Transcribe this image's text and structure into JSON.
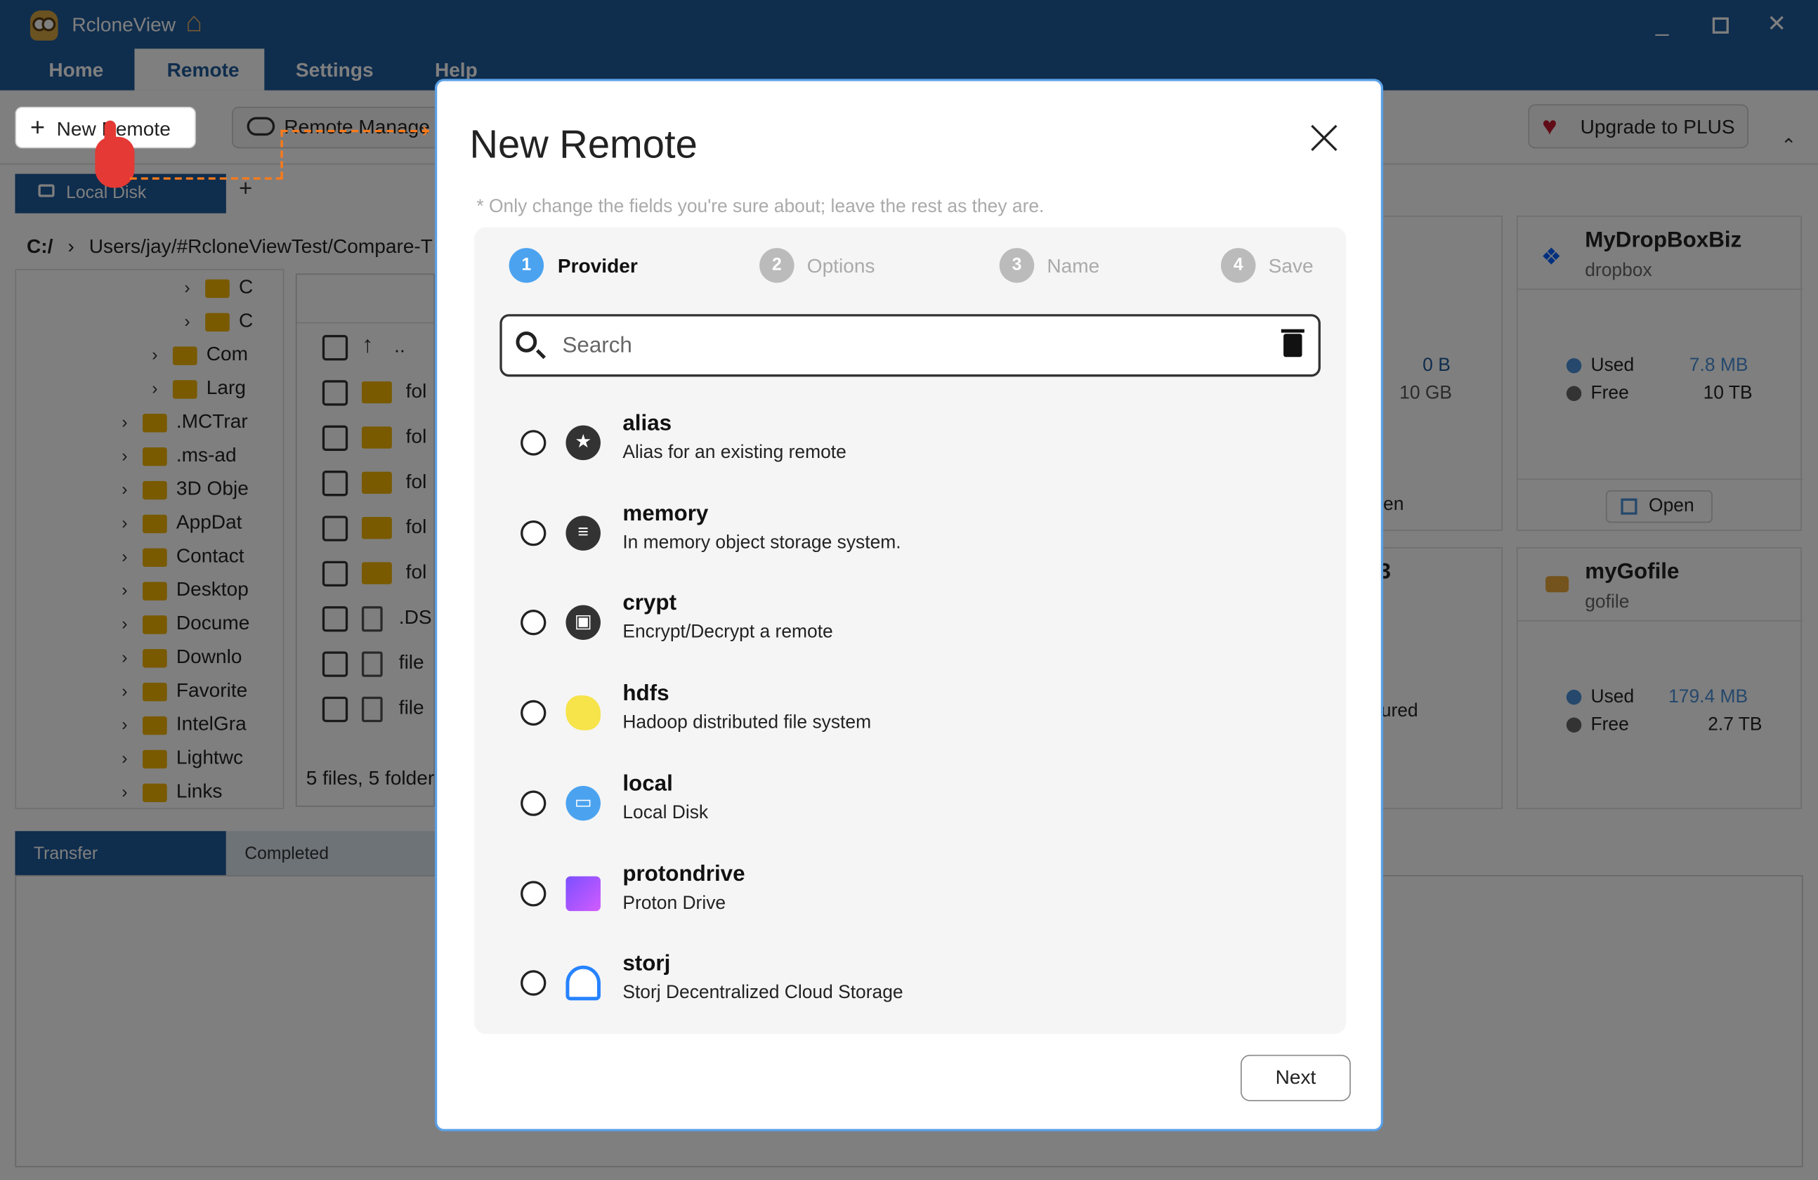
{
  "app": {
    "title": "RcloneView"
  },
  "menu_tabs": [
    "Home",
    "Remote",
    "Settings",
    "Help"
  ],
  "toolbar": {
    "new_remote": "New Remote",
    "remote_manager": "Remote Manage",
    "upgrade": "Upgrade to PLUS"
  },
  "left_panel": {
    "tab": "Local Disk",
    "path_root": "C:/",
    "path": "Users/jay/#RcloneViewTest/Compare-T",
    "tree_items": [
      "C",
      "C",
      "Com",
      "Larg",
      ".MCTrar",
      ".ms-ad",
      "3D Obje",
      "AppDat",
      "Contact",
      "Desktop",
      "Docume",
      "Downlo",
      "Favorite",
      "IntelGra",
      "Lightwc",
      "Links"
    ],
    "files": [
      "..",
      "fol",
      "fol",
      "fol",
      "fol",
      "fol",
      ".DS",
      "file",
      "file"
    ],
    "status": "5 files, 5 folder"
  },
  "bottom_tabs": [
    "Transfer",
    "Completed"
  ],
  "remote_cards": [
    {
      "name": "MyDropBoxBiz",
      "type": "dropbox",
      "used_label": "Used",
      "used": "7.8 MB",
      "free_label": "Free",
      "free": "10 TB",
      "open": "Open"
    },
    {
      "name": "myGofile",
      "type": "gofile",
      "used_label": "Used",
      "used": "179.4 MB",
      "free_label": "Free",
      "free": "2.7 TB"
    }
  ],
  "hidden_card": {
    "used": "0 B",
    "free": "10 GB",
    "open_partial": "en",
    "b_partial": "3",
    "status_partial": "ured"
  },
  "dialog": {
    "title": "New Remote",
    "note": "* Only change the fields you're sure about; leave the rest as they are.",
    "steps": [
      {
        "num": "1",
        "label": "Provider"
      },
      {
        "num": "2",
        "label": "Options"
      },
      {
        "num": "3",
        "label": "Name"
      },
      {
        "num": "4",
        "label": "Save"
      }
    ],
    "search_placeholder": "Search",
    "providers": [
      {
        "name": "alias",
        "desc": "Alias for an existing remote",
        "icon": "star-icon"
      },
      {
        "name": "memory",
        "desc": "In memory object storage system.",
        "icon": "database-icon"
      },
      {
        "name": "crypt",
        "desc": "Encrypt/Decrypt a remote",
        "icon": "lock-icon"
      },
      {
        "name": "hdfs",
        "desc": "Hadoop distributed file system",
        "icon": "hadoop-elephant-icon"
      },
      {
        "name": "local",
        "desc": "Local Disk",
        "icon": "monitor-icon"
      },
      {
        "name": "protondrive",
        "desc": "Proton Drive",
        "icon": "proton-folder-icon"
      },
      {
        "name": "storj",
        "desc": "Storj Decentralized Cloud Storage",
        "icon": "storj-icon"
      }
    ],
    "next": "Next"
  },
  "colors": {
    "accent": "#1e5a9a",
    "step_active": "#4ba3f0",
    "dialog_border": "#5aa0e6",
    "pointer": "#ff7a1a"
  }
}
